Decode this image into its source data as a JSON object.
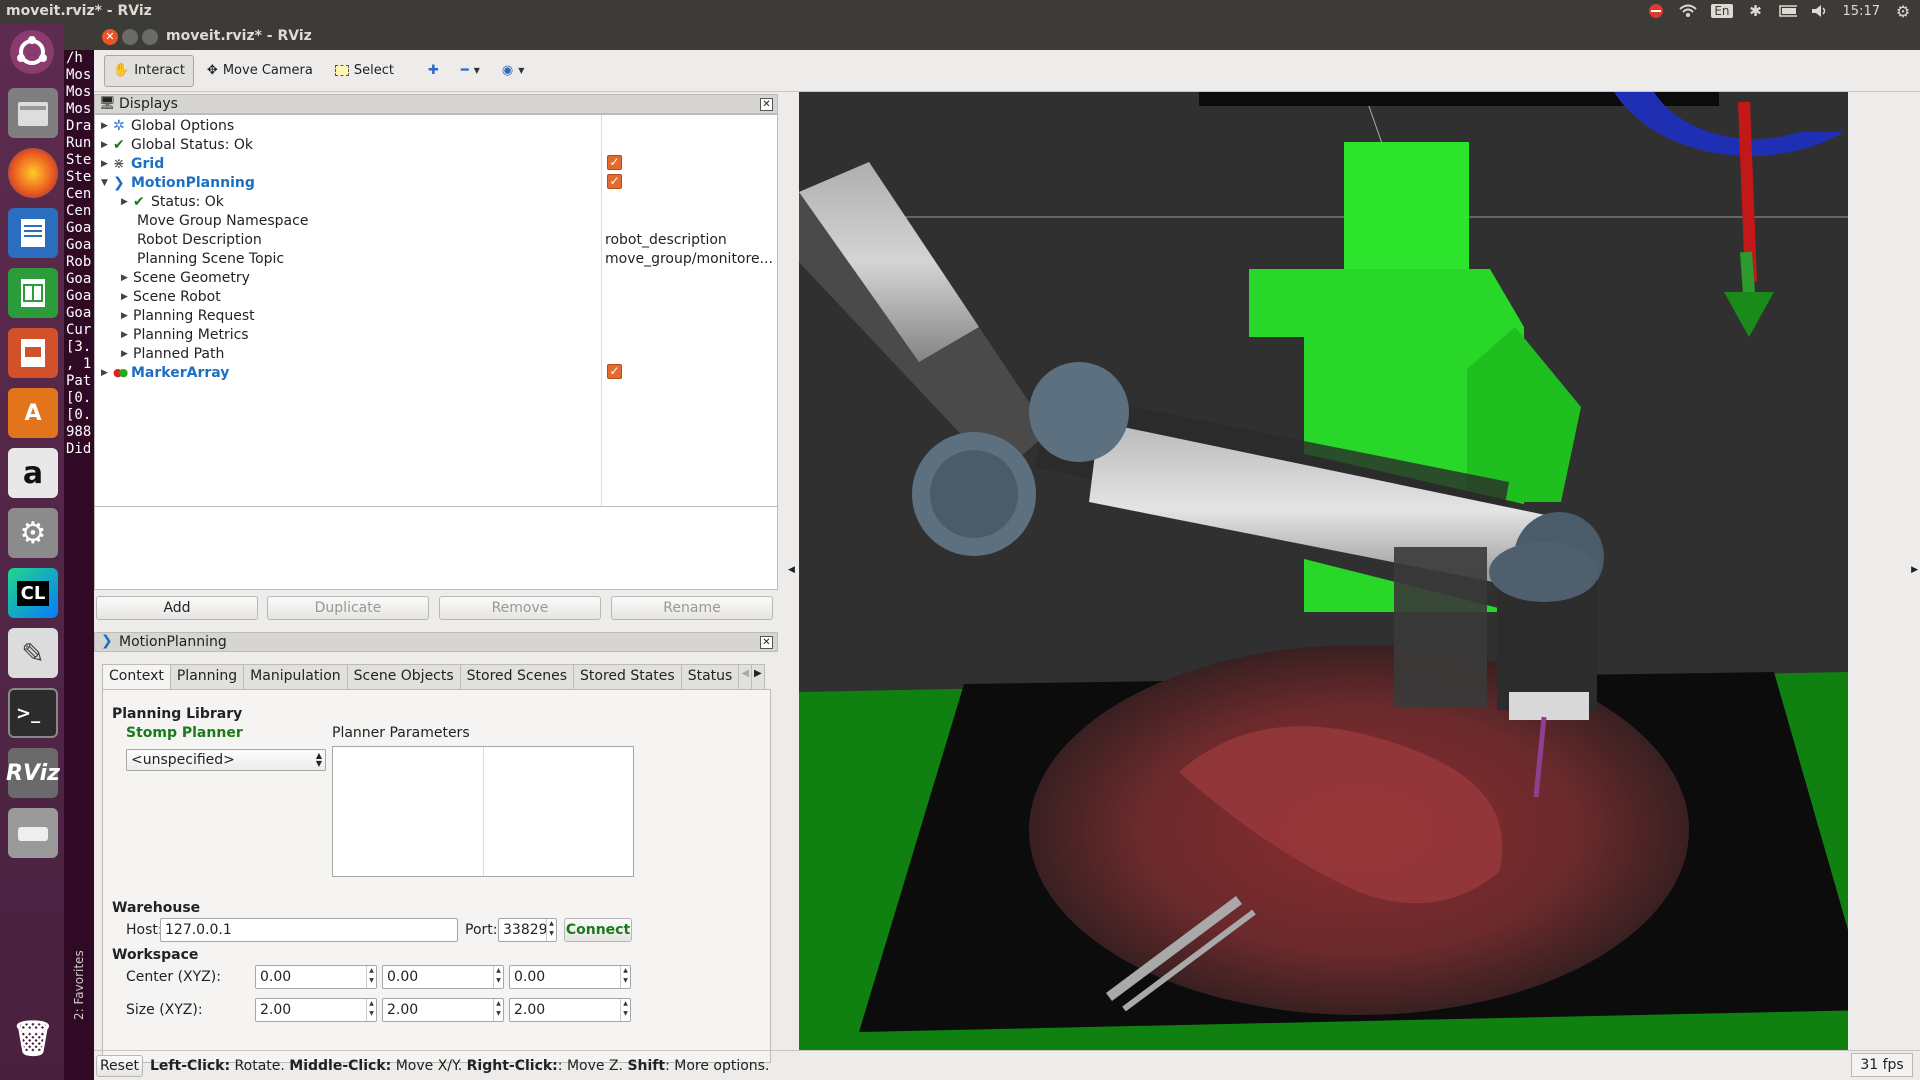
{
  "system": {
    "title": "moveit.rviz* - RViz",
    "lang": "En",
    "time": "15:17"
  },
  "window": {
    "title": "moveit.rviz* - RViz"
  },
  "terminal": {
    "lines": [
      "/h",
      "Mos",
      "Mos",
      "Mos",
      "Dra",
      "Run",
      "Ste",
      "Ste",
      "Cen",
      "Cen",
      "Goa",
      "Goa",
      "Rob",
      "Goa",
      "Goa",
      "Goa",
      "Cur",
      "[3.",
      ", 1",
      "Pat",
      "[0.",
      "[0.",
      "988",
      "Did"
    ]
  },
  "toolbar": {
    "interact": "Interact",
    "move_camera": "Move Camera",
    "select": "Select"
  },
  "displays": {
    "title": "Displays",
    "items": {
      "global_options": "Global Options",
      "global_status": "Global Status: Ok",
      "grid": "Grid",
      "motion_planning": "MotionPlanning",
      "status": "Status: Ok",
      "move_group_ns": "Move Group Namespace",
      "robot_description": "Robot Description",
      "robot_description_val": "robot_description",
      "planning_scene_topic": "Planning Scene Topic",
      "planning_scene_topic_val": "move_group/monitore...",
      "scene_geometry": "Scene Geometry",
      "scene_robot": "Scene Robot",
      "planning_request": "Planning Request",
      "planning_metrics": "Planning Metrics",
      "planned_path": "Planned Path",
      "marker_array": "MarkerArray"
    },
    "buttons": {
      "add": "Add",
      "duplicate": "Duplicate",
      "remove": "Remove",
      "rename": "Rename"
    }
  },
  "motion_panel": {
    "title": "MotionPlanning",
    "tabs": [
      "Context",
      "Planning",
      "Manipulation",
      "Scene Objects",
      "Stored Scenes",
      "Stored States",
      "Status"
    ],
    "planning_library": "Planning Library",
    "planner": "Stomp Planner",
    "planner_select": "<unspecified>",
    "planner_params": "Planner Parameters",
    "warehouse": "Warehouse",
    "host_label": "Host:",
    "host": "127.0.0.1",
    "port_label": "Port:",
    "port": "33829",
    "connect": "Connect",
    "workspace": "Workspace",
    "center_label": "Center (XYZ):",
    "center": [
      "0.00",
      "0.00",
      "0.00"
    ],
    "size_label": "Size (XYZ):",
    "size": [
      "2.00",
      "2.00",
      "2.00"
    ]
  },
  "statusbar": {
    "reset": "Reset",
    "left": "Left-Click:",
    "left_t": " Rotate. ",
    "middle": "Middle-Click:",
    "middle_t": " Move X/Y. ",
    "right": "Right-Click:",
    "right_t": ": Move Z. ",
    "shift": "Shift",
    "shift_t": ": More options.",
    "fps": "31 fps"
  },
  "favorites": "2: Favorites",
  "colors": {
    "accent_blue": "#1d6fc4",
    "check_orange": "#e26b2d",
    "connect_green": "#1a7a1a",
    "scene_green": "#22c022"
  }
}
